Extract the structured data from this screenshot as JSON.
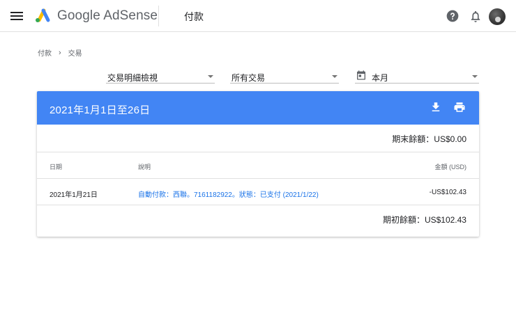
{
  "app": {
    "brand": "Google AdSense",
    "page_title": "付款"
  },
  "icons": {
    "menu": "hamburger-menu-icon",
    "help": "help-icon",
    "notifications": "bell-icon",
    "download": "download-icon",
    "print": "print-icon",
    "calendar": "calendar-icon"
  },
  "colors": {
    "header_blue": "#4285f4",
    "link_blue": "#1a73e8",
    "logo_blue": "#4285f4",
    "logo_yellow": "#fbbc04",
    "logo_green": "#34a853"
  },
  "breadcrumb": {
    "items": [
      "付款",
      "交易"
    ],
    "separator": "›"
  },
  "filters": {
    "view": "交易明細檢視",
    "type": "所有交易",
    "period": "本月"
  },
  "card": {
    "title": "2021年1月1日至26日",
    "closing_balance": "期末餘額：US$0.00",
    "opening_balance": "期初餘額：US$102.43",
    "columns": {
      "date": "日期",
      "description": "說明",
      "amount": "金額 (USD)"
    },
    "rows": [
      {
        "date": "2021年1月21日",
        "description": "自動付款：西聯。7161182922。狀態：已支付 (2021/1/22)",
        "amount": "-US$102.43"
      }
    ]
  }
}
